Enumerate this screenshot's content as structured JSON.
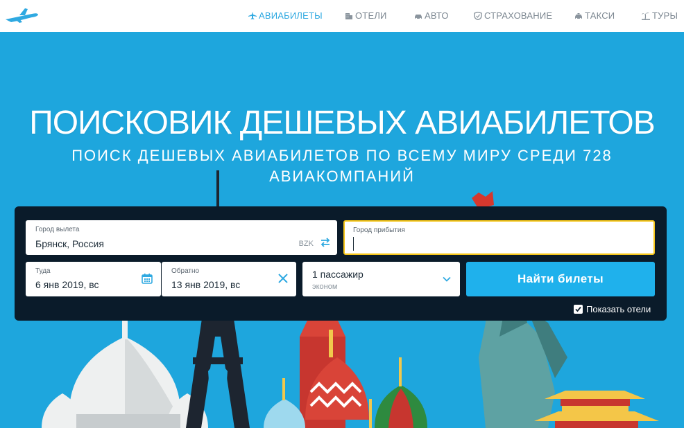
{
  "nav": {
    "items": [
      {
        "label": "АВИАБИЛЕТЫ",
        "icon": "plane-icon",
        "active": true
      },
      {
        "label": "ОТЕЛИ",
        "icon": "hotel-icon",
        "active": false
      },
      {
        "label": "АВТО",
        "icon": "car-icon",
        "active": false
      },
      {
        "label": "СТРАХОВАНИЕ",
        "icon": "shield-icon",
        "active": false
      },
      {
        "label": "ТАКСИ",
        "icon": "taxi-icon",
        "active": false
      },
      {
        "label": "ТУРЫ",
        "icon": "palm-icon",
        "active": false
      }
    ]
  },
  "hero": {
    "title": "ПОИСКОВИК ДЕШЕВЫХ АВИАБИЛЕТОВ",
    "subtitle_part1": "ПОИСК ДЕШЕВЫХ АВИАБИЛЕТОВ ПО ВСЕМУ МИРУ СРЕДИ",
    "subtitle_number": "728",
    "subtitle_part2": "АВИАКОМПАНИЙ"
  },
  "search": {
    "from_label": "Город вылета",
    "from_value": "Брянск, Россия",
    "from_code": "BZK",
    "to_label": "Город прибытия",
    "to_value": "",
    "depart_label": "Туда",
    "depart_value": "6 янв 2019, вс",
    "return_label": "Обратно",
    "return_value": "13 янв 2019, вс",
    "passengers_value": "1 пассажир",
    "class_value": "эконом",
    "submit_label": "Найти билеты",
    "show_hotels_label": "Показать отели",
    "show_hotels_checked": true
  },
  "colors": {
    "accent": "#2fa9e1",
    "hero_bg": "#1ea6dd",
    "panel_bg": "#0a1b2a",
    "button": "#1fb1ec",
    "focus_border": "#f5c518"
  }
}
